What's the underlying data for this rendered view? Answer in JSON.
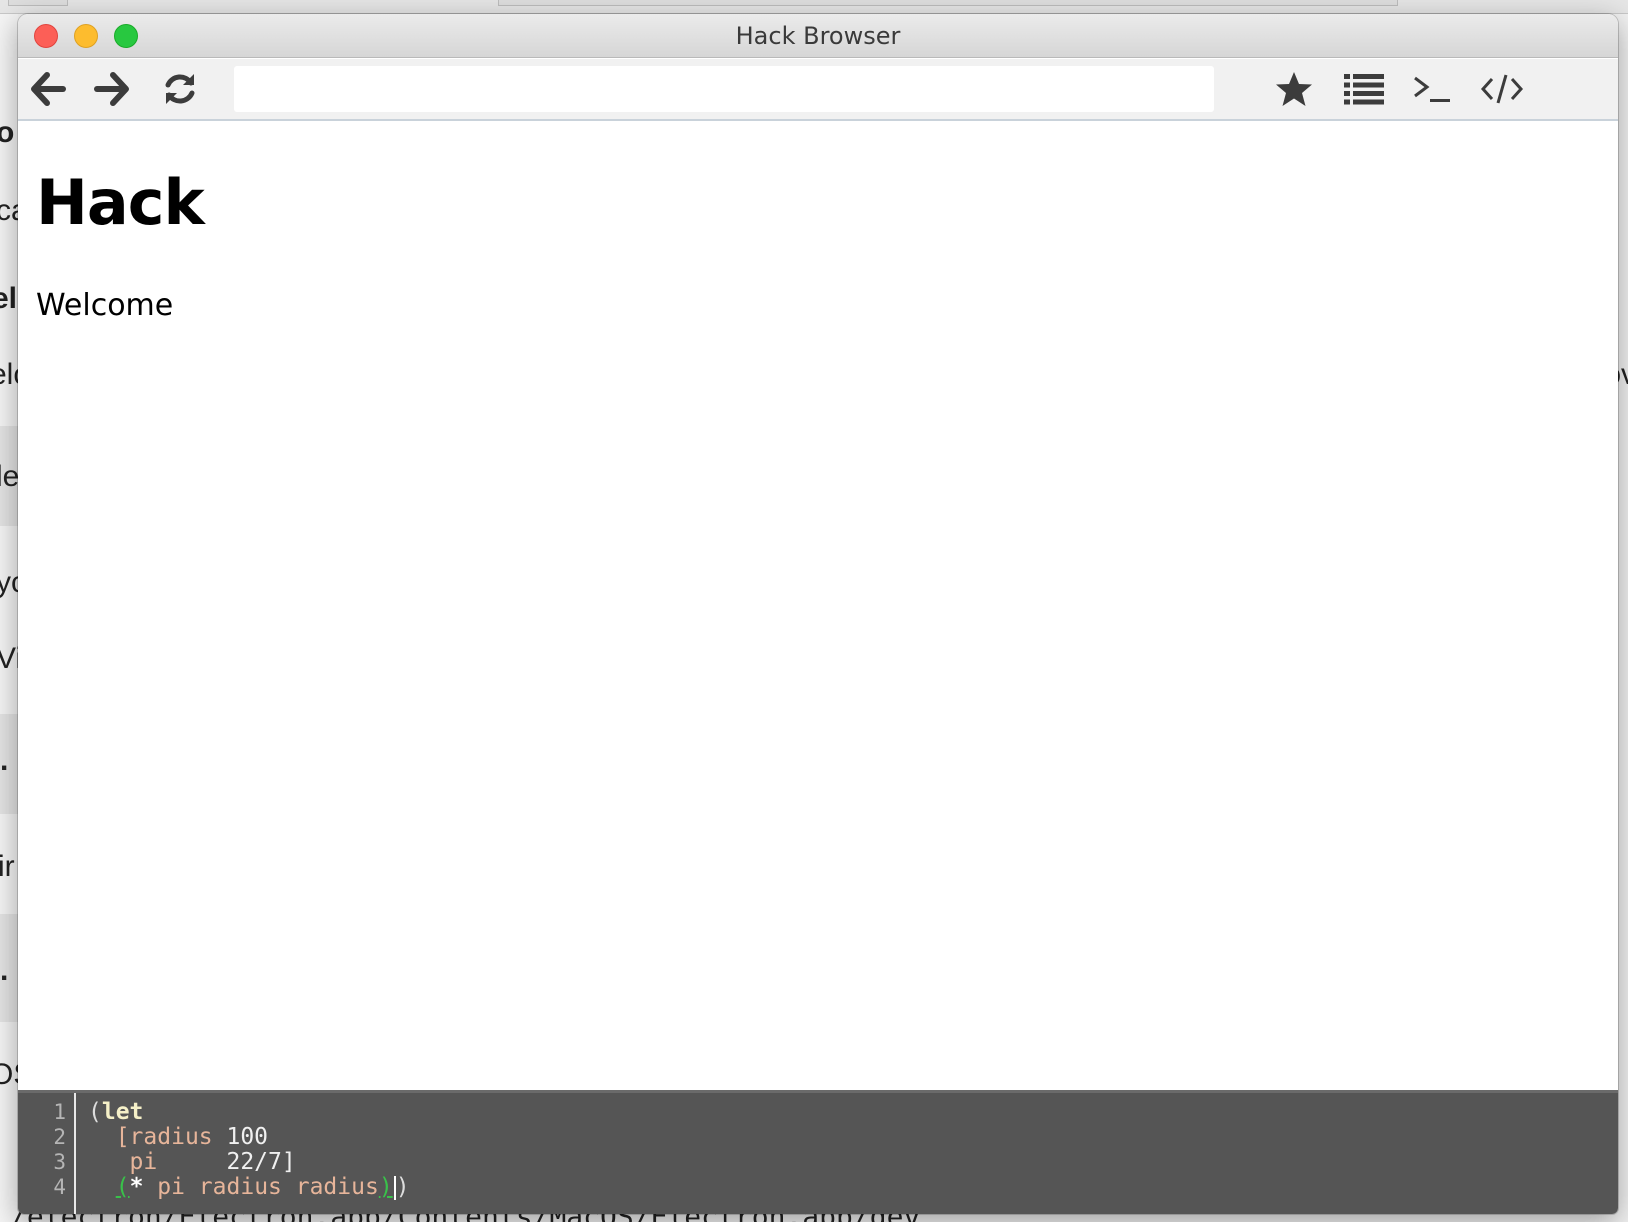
{
  "background": {
    "fragments_left": [
      "o",
      "ca",
      "el",
      "elc",
      "le",
      "yc",
      "Vi",
      ".",
      "ir",
      ".",
      "OS"
    ],
    "fragments_right": [
      "ov"
    ],
    "bottom_text": "/electron/Electron.app/Contents/MacOS/Electron.app/dev"
  },
  "window": {
    "title": "Hack Browser",
    "traffic_lights": [
      "close",
      "minimize",
      "maximize"
    ]
  },
  "toolbar": {
    "back_icon": "arrow-left-icon",
    "forward_icon": "arrow-right-icon",
    "reload_icon": "refresh-icon",
    "url": "",
    "url_placeholder": "",
    "bookmark_icon": "star-icon",
    "list_icon": "list-icon",
    "terminal_icon": "terminal-icon",
    "devtools_icon": "code-icon",
    "accent_color": "#3c3c3c"
  },
  "page": {
    "heading": "Hack",
    "text": "Welcome"
  },
  "editor": {
    "line_numbers": [
      "1",
      "2",
      "3",
      "4"
    ],
    "lines": [
      {
        "open": "(",
        "keyword": "let"
      },
      {
        "indent": "  ",
        "text_a": "[radius",
        "text_b": " 100"
      },
      {
        "indent": "   ",
        "text_a": "pi",
        "text_b": "     22/7]"
      },
      {
        "indent": "  ",
        "open": "(",
        "op": "*",
        "rest": " pi radius radius",
        "close": ")",
        "final": ")"
      }
    ],
    "background_color": "#555555"
  }
}
